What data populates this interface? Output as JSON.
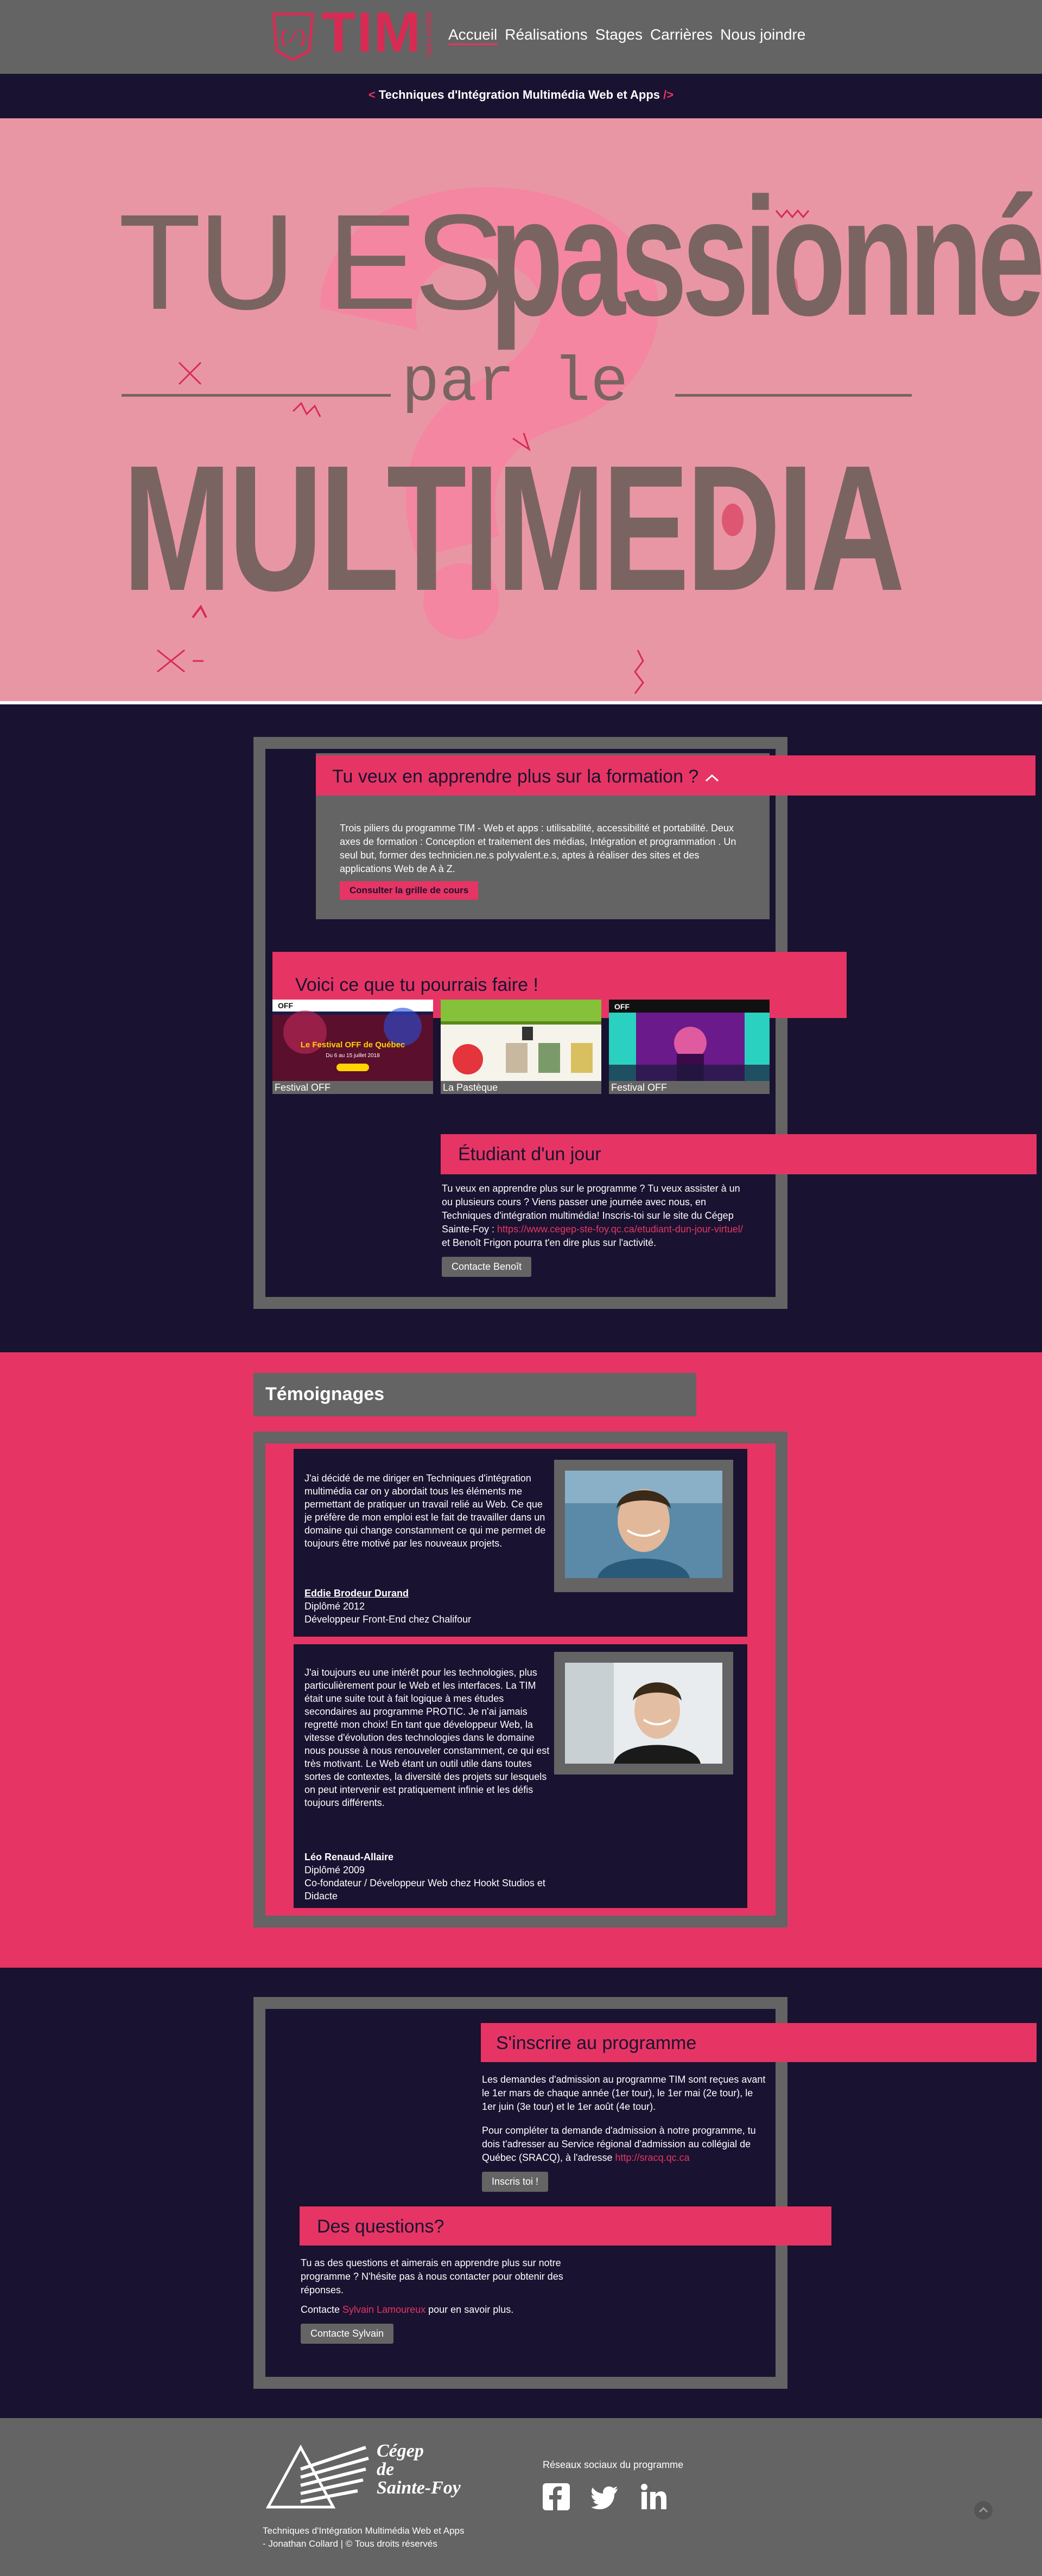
{
  "header": {
    "logo_text": "TIM",
    "logo_vertical": "WEB ET APPS",
    "nav": [
      "Accueil",
      "Réalisations",
      "Stages",
      "Carrières",
      "Nous joindre"
    ]
  },
  "subtitle": {
    "open": "< ",
    "text": "Techniques d'Intégration Multimédia Web et Apps",
    "close": " />"
  },
  "hero": {
    "line1a": "TU ES",
    "line1b": "passionné",
    "line2": "par le",
    "line3": "MULTIMEDIA"
  },
  "formation": {
    "title": "Tu veux en apprendre plus sur la formation ?",
    "text": "Trois piliers du programme TIM - Web et apps : utilisabilité, accessibilité et portabilité. Deux axes de formation : Conception et traitement des médias,  Intégration et programmation . Un seul but, former des technicien.ne.s polyvalent.e.s, aptes à réaliser des sites et des applications Web de A à Z.",
    "button": "Consulter la grille de cours"
  },
  "realisations": {
    "title": "Voici ce que tu pourrais faire !",
    "items": [
      {
        "label": "Festival OFF",
        "caption": "Le Festival OFF de Québec",
        "dates": "Du 6 au 15 juillet 2018"
      },
      {
        "label": "La Pastèque",
        "caption": ""
      },
      {
        "label": "Festival OFF",
        "caption": ""
      }
    ]
  },
  "etudiant": {
    "title": "Étudiant d'un jour",
    "text_before": "Tu veux en apprendre plus sur le programme ? Tu veux assister à un ou plusieurs cours ? Viens passer une journée avec nous, en Techniques d'intégration multimédia! Inscris-toi sur le site du Cégep Sainte-Foy : ",
    "link": "https://www.cegep-ste-foy.qc.ca/etudiant-dun-jour-virtuel/",
    "text_after": " et Benoît Frigon pourra t'en dire plus sur l'activité.",
    "button": "Contacte Benoît"
  },
  "temoignages": {
    "title": "Témoignages",
    "items": [
      {
        "text": "J'ai décidé de me diriger en Techniques d'intégration multimédia car on y abordait tous les éléments me permettant de pratiquer un travail relié au Web. Ce que je préfère de mon emploi est le fait de travailler dans un domaine qui change constamment ce qui me permet de toujours être motivé par les nouveaux projets.",
        "name": "Eddie Brodeur Durand",
        "diploma": "Diplômé 2012",
        "role": "Développeur Front-End chez Chalifour"
      },
      {
        "text": "J'ai toujours eu une intérêt pour les technologies, plus particulièrement pour le Web et les interfaces. La TIM était une suite tout à fait logique à mes études secondaires au programme PROTIC. Je n'ai jamais regretté mon choix! En tant que développeur Web, la vitesse d'évolution des technologies dans le domaine nous pousse à nous renouveler constamment, ce qui est très motivant. Le Web étant un outil utile dans toutes sortes de contextes, la diversité des projets sur lesquels on peut intervenir est pratiquement infinie et les défis toujours différents.",
        "name": "Léo Renaud-Allaire",
        "diploma": "Diplômé 2009",
        "role": "Co-fondateur / Développeur Web chez Hookt Studios et Didacte"
      }
    ]
  },
  "inscription": {
    "title": "S'inscrire au programme",
    "text1": "Les demandes d'admission au programme TIM sont reçues avant le 1er mars de chaque année (1er tour), le 1er mai (2e tour), le 1er juin (3e tour) et le 1er août (4e tour).",
    "text2_before": "Pour compléter ta demande d'admission à notre programme, tu dois t'adresser au Service régional d'admission au collégial de Québec (SRACQ), à l'adresse ",
    "text2_link": "http://sracq.qc.ca",
    "button": "Inscris toi !"
  },
  "questions": {
    "title": "Des questions?",
    "text": "Tu as des questions et aimerais en apprendre plus sur notre programme ? N'hésite pas à nous contacter pour obtenir des réponses.",
    "contact_before": "Contacte ",
    "contact_link": "Sylvain Lamoureux",
    "contact_after": " pour en savoir plus.",
    "button": "Contacte Sylvain"
  },
  "footer": {
    "cegep_line1": "Cégep",
    "cegep_line2": "de",
    "cegep_line3": "Sainte-Foy",
    "copyright": "Techniques d'Intégration Multimédia Web et Apps - Jonathan Collard | © Tous droits réservés",
    "social_title": "Réseaux sociaux du programme"
  },
  "colors": {
    "accent": "#e63564",
    "dark": "#191230",
    "gray": "#646464",
    "hero": "#e996a4"
  }
}
